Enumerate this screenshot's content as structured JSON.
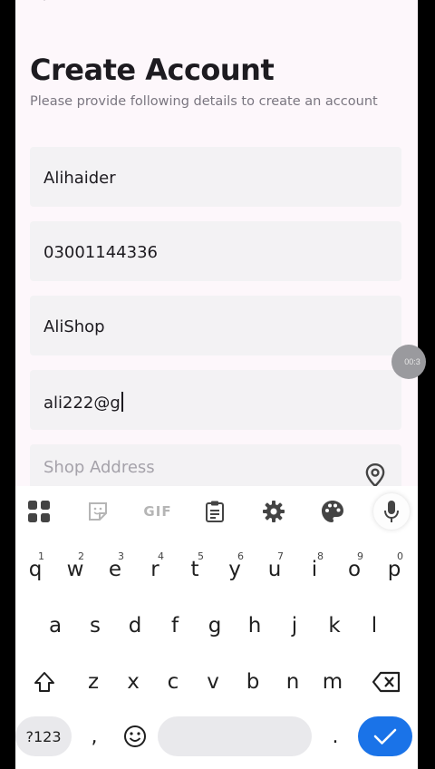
{
  "header": {
    "title": "Create Account",
    "subtitle": "Please provide following details to create an account"
  },
  "form": {
    "name_value": "Alihaider",
    "phone_value": "03001144336",
    "shop_value": "AliShop",
    "email_value": "ali222@g",
    "address_placeholder": "Shop Address"
  },
  "recording": {
    "time": "00:3"
  },
  "keyboard": {
    "toolbar_icons": [
      "apps-grid-icon",
      "sticker-icon",
      "gif-icon",
      "clipboard-icon",
      "settings-gear-icon",
      "palette-icon",
      "microphone-icon"
    ],
    "gif_label": "GIF",
    "row1": [
      "q",
      "w",
      "e",
      "r",
      "t",
      "y",
      "u",
      "i",
      "o",
      "p"
    ],
    "row1_hints": [
      "1",
      "2",
      "3",
      "4",
      "5",
      "6",
      "7",
      "8",
      "9",
      "0"
    ],
    "row2": [
      "a",
      "s",
      "d",
      "f",
      "g",
      "h",
      "j",
      "k",
      "l"
    ],
    "row3": [
      "z",
      "x",
      "c",
      "v",
      "b",
      "n",
      "m"
    ],
    "symbols_label": "?123",
    "comma_label": ",",
    "period_label": ".",
    "accent_color": "#1a73e8"
  }
}
